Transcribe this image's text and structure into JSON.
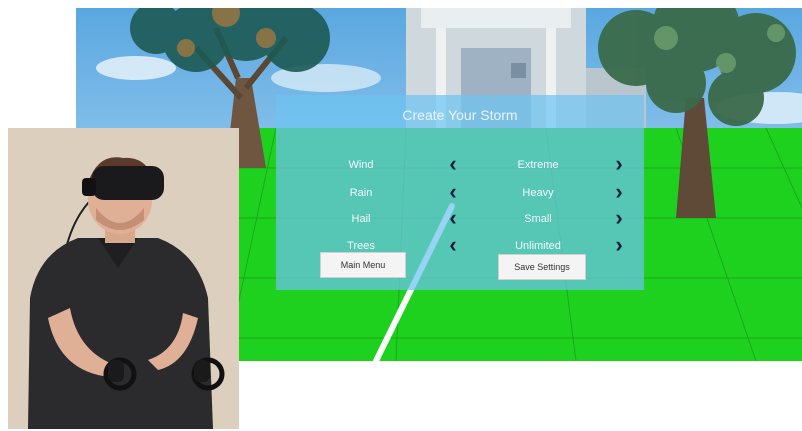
{
  "panel": {
    "title": "Create Your Storm",
    "rows": [
      {
        "label": "Wind",
        "value": "Extreme"
      },
      {
        "label": "Rain",
        "value": "Heavy"
      },
      {
        "label": "Hail",
        "value": "Small"
      },
      {
        "label": "Trees",
        "value": "Unlimited"
      }
    ],
    "main_menu_label": "Main Menu",
    "save_label": "Save Settings"
  },
  "colors": {
    "sky": "#8cc4ec",
    "grass": "#1fd41f",
    "panel": "#6ec3f0"
  },
  "icons": {
    "prev": "chevron-left-icon",
    "next": "chevron-right-icon"
  }
}
